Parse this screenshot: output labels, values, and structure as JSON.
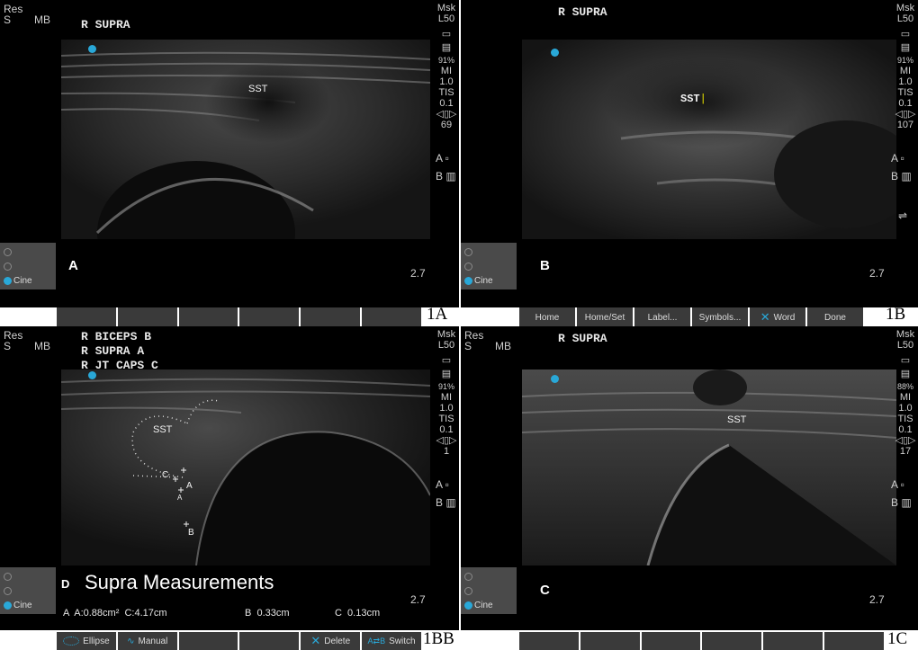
{
  "panels": {
    "a": {
      "res": "Res",
      "s": "S",
      "mb": "MB",
      "title": "R SUPRA",
      "probe": "Msk",
      "probe_model": "L50",
      "gain": "91%",
      "mi_label": "MI",
      "mi": "1.0",
      "tis_label": "TIS",
      "tis": "0.1",
      "frame": "69",
      "a_icon": "A",
      "b_icon": "B",
      "sst": "SST",
      "letter": "A",
      "depth": "2.7",
      "cine": "Cine",
      "figure": "1A"
    },
    "b": {
      "title": "R SUPRA",
      "probe": "Msk",
      "probe_model": "L50",
      "gain": "91%",
      "mi_label": "MI",
      "mi": "1.0",
      "tis_label": "TIS",
      "tis": "0.1",
      "frame": "107",
      "a_icon": "A",
      "b_icon": "B",
      "sst": "SST",
      "letter": "B",
      "depth": "2.7",
      "cine": "Cine",
      "buttons": [
        "Home",
        "Home/Set",
        "Label...",
        "Symbols...",
        "Word",
        "Done"
      ],
      "figure": "1B"
    },
    "d": {
      "res": "Res",
      "s": "S",
      "mb": "MB",
      "title_lines": [
        "R BICEPS B",
        "R SUPRA A",
        "R JT CAPS C"
      ],
      "probe": "Msk",
      "probe_model": "L50",
      "gain": "91%",
      "mi_label": "MI",
      "mi": "1.0",
      "tis_label": "TIS",
      "tis": "0.1",
      "frame": "1",
      "a_icon": "A",
      "b_icon": "B",
      "sst": "SST",
      "markers": [
        "C",
        "A",
        "B",
        "A"
      ],
      "letter": "D",
      "heading": "Supra Measurements",
      "depth": "2.7",
      "cine": "Cine",
      "measure_a": "A  A:0.88cm²  C:4.17cm",
      "measure_b": "B  0.33cm",
      "measure_c": "C  0.13cm",
      "buttons": [
        "Ellipse",
        "Manual",
        "",
        "",
        "Delete",
        "Switch"
      ],
      "figure": "1BB"
    },
    "c": {
      "res": "Res",
      "s": "S",
      "mb": "MB",
      "title": "R SUPRA",
      "probe": "Msk",
      "probe_model": "L50",
      "gain": "88%",
      "mi_label": "MI",
      "mi": "1.0",
      "tis_label": "TIS",
      "tis": "0.1",
      "frame": "17",
      "a_icon": "A",
      "b_icon": "B",
      "sst": "SST",
      "letter": "C",
      "depth": "2.7",
      "cine": "Cine",
      "figure": "1C"
    }
  },
  "colors": {
    "accent": "#29a8d8",
    "button": "#3a3a3a",
    "cine_panel": "#4a4a4a"
  }
}
